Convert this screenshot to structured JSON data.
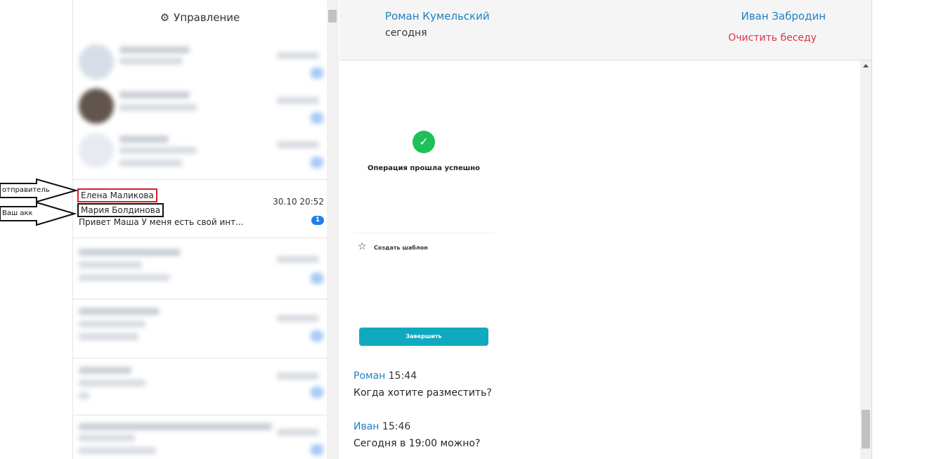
{
  "sidebar": {
    "header_icon": "gears-icon",
    "header_title": "Управление",
    "active_chat": {
      "sender": "Елена Маликова",
      "account": "Мария Болдинова",
      "preview": "Привет Маша У меня есть свой инт...",
      "time": "30.10 20:52",
      "unread": "1"
    }
  },
  "annotations": {
    "sender_label": "отправитель",
    "account_label": "Ваш акк"
  },
  "conversation": {
    "left_name": "Роман Кумельский",
    "date": "сегодня",
    "right_name": "Иван Забродин",
    "clear_label": "Очистить беседу",
    "attachment": {
      "status_icon": "check-icon",
      "status_text": "Операция прошла успешно",
      "template_icon": "star-icon",
      "template_text": "Создать шаблон",
      "finish_button": "Завершить"
    },
    "messages": [
      {
        "author": "Роман",
        "time": "15:44",
        "text": "Когда хотите разместить?"
      },
      {
        "author": "Иван",
        "time": "15:46",
        "text": "Сегодня в 19:00 можно?"
      }
    ]
  },
  "colors": {
    "link_blue": "#1f80c3",
    "danger_red": "#dc3545",
    "badge_blue": "#1e80e8",
    "success_green": "#1fbf5a",
    "finish_teal": "#10aac0"
  }
}
